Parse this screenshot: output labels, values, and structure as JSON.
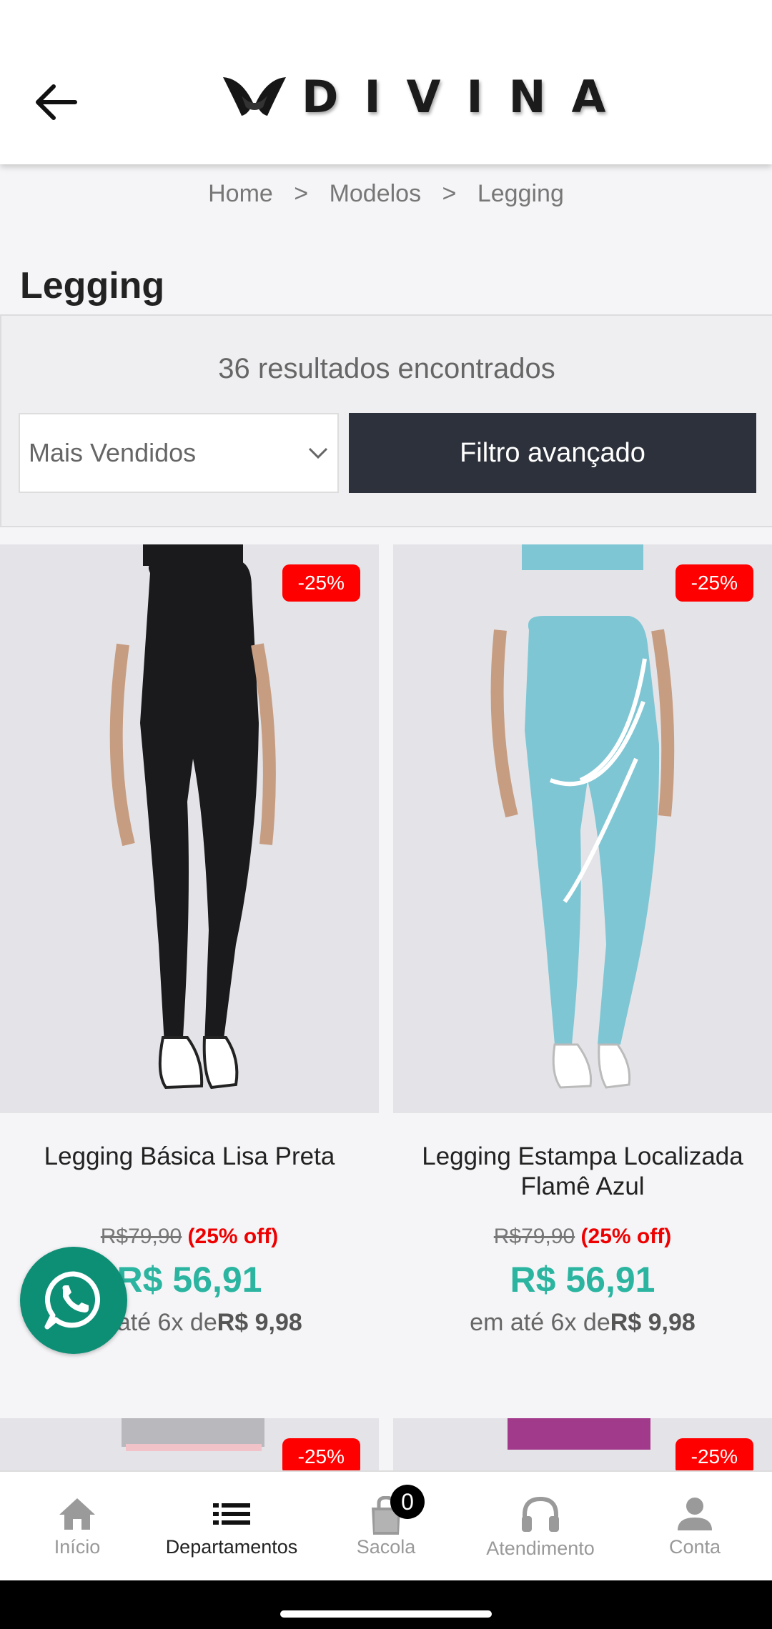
{
  "header": {
    "brand": "DIVINA"
  },
  "breadcrumb": {
    "items": [
      "Home",
      "Modelos",
      "Legging"
    ],
    "separator": ">"
  },
  "page": {
    "title": "Legging"
  },
  "filters": {
    "results_text": "36 resultados encontrados",
    "sort_selected": "Mais Vendidos",
    "filter_button": "Filtro avançado"
  },
  "products": [
    {
      "badge": "-25%",
      "name": "Legging Básica Lisa Preta",
      "old_price": "R$79,90",
      "discount": "(25% off)",
      "price": "R$ 56,91",
      "installments_prefix": "em até 6x de",
      "installment_value": "R$ 9,98",
      "color": "#1a1a1c"
    },
    {
      "badge": "-25%",
      "name": "Legging Estampa Localizada Flamê Azul",
      "old_price": "R$79,90",
      "discount": "(25% off)",
      "price": "R$ 56,91",
      "installments_prefix": "em até 6x de",
      "installment_value": "R$ 9,98",
      "color": "#7fc6d4"
    },
    {
      "badge": "-25%",
      "color": "#b9b9bd"
    },
    {
      "badge": "-25%",
      "color": "#a23a8c"
    }
  ],
  "bottom_nav": [
    {
      "label": "Início",
      "icon": "home-icon"
    },
    {
      "label": "Departamentos",
      "icon": "list-icon"
    },
    {
      "label": "Sacola",
      "icon": "bag-icon",
      "count": "0"
    },
    {
      "label": "Atendimento",
      "icon": "headphones-icon"
    },
    {
      "label": "Conta",
      "icon": "user-icon"
    }
  ],
  "colors": {
    "accent_price": "#2bb5a1",
    "badge": "#ff0000",
    "filter_button": "#2d313b",
    "whatsapp": "#0d8f76"
  }
}
